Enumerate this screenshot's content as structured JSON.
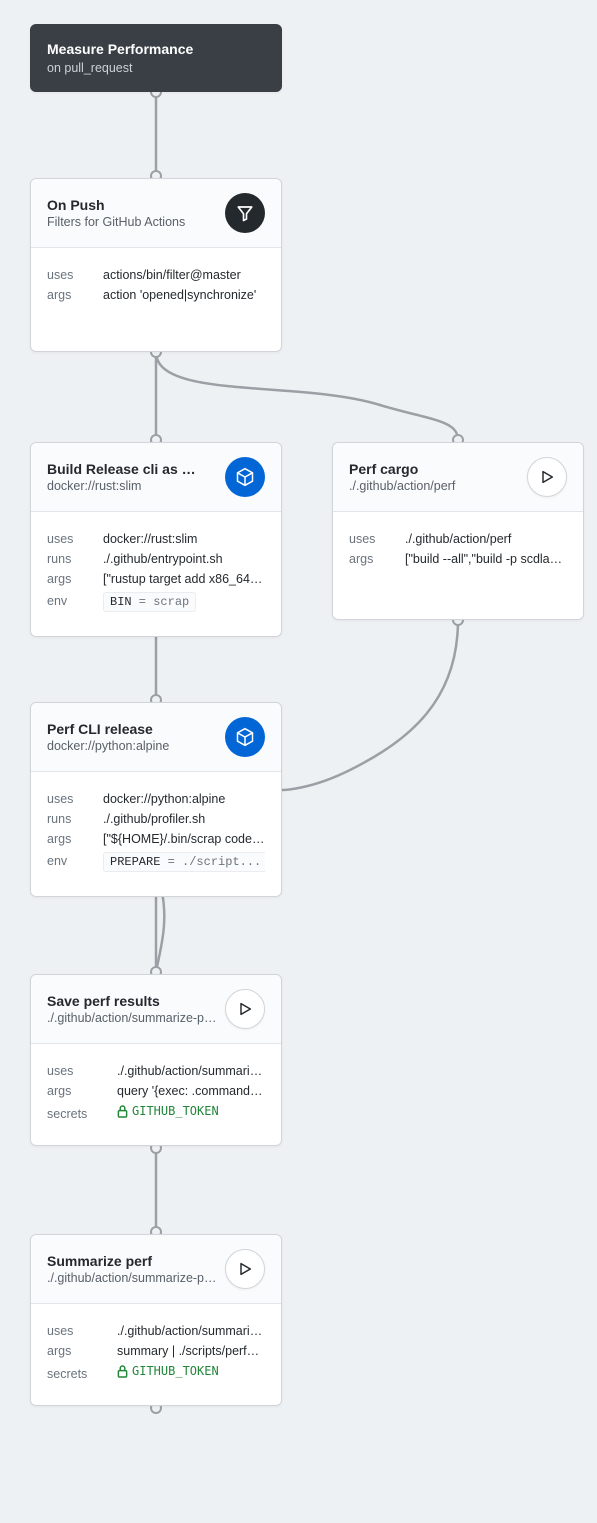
{
  "colors": {
    "accent_blue": "#0366d6",
    "edge": "#9ba0a6",
    "bg": "#eef1f3",
    "secret_green": "#22863a"
  },
  "workflow": {
    "title": "Measure Performance",
    "trigger": "on pull_request"
  },
  "nodes": {
    "onpush": {
      "title": "On Push",
      "subtitle": "Filters for GitHub Actions",
      "icon": "filter",
      "rows": [
        {
          "k": "uses",
          "v": "actions/bin/filter@master"
        },
        {
          "k": "args",
          "v": "action 'opened|synchronize'"
        }
      ]
    },
    "build": {
      "title": "Build Release cli as …",
      "subtitle": "docker://rust:slim",
      "icon": "package",
      "rows": [
        {
          "k": "uses",
          "v": "docker://rust:slim"
        },
        {
          "k": "runs",
          "v": "./.github/entrypoint.sh"
        },
        {
          "k": "args",
          "v": "[\"rustup target add x86_64-…"
        }
      ],
      "env": {
        "key": "BIN",
        "val": "scrap"
      }
    },
    "perfcargo": {
      "title": "Perf cargo",
      "subtitle": "./.github/action/perf",
      "icon": "play",
      "rows": [
        {
          "k": "uses",
          "v": "./.github/action/perf"
        },
        {
          "k": "args",
          "v": "[\"build --all\",\"build -p scdla…"
        }
      ]
    },
    "perfcli": {
      "title": "Perf CLI release",
      "subtitle": "docker://python:alpine",
      "icon": "package",
      "rows": [
        {
          "k": "uses",
          "v": "docker://python:alpine"
        },
        {
          "k": "runs",
          "v": "./.github/profiler.sh"
        },
        {
          "k": "args",
          "v": "[\"${HOME}/.bin/scrap code …"
        }
      ],
      "env": {
        "key": "PREPARE",
        "val": "./script..."
      }
    },
    "save": {
      "title": "Save perf results",
      "subtitle": "./.github/action/summarize-perf",
      "icon": "play",
      "rows": [
        {
          "k": "uses",
          "v": "./.github/action/summarize-…"
        },
        {
          "k": "args",
          "v": "query '{exec: .command, m…"
        }
      ],
      "secret": "GITHUB_TOKEN"
    },
    "summarize": {
      "title": "Summarize perf",
      "subtitle": "./.github/action/summarize-perf",
      "icon": "play",
      "rows": [
        {
          "k": "uses",
          "v": "./.github/action/summarize-…"
        },
        {
          "k": "args",
          "v": "summary | ./scripts/perfsum…"
        }
      ],
      "secret": "GITHUB_TOKEN"
    }
  },
  "labels": {
    "uses": "uses",
    "runs": "runs",
    "args": "args",
    "env": "env",
    "secrets": "secrets"
  }
}
